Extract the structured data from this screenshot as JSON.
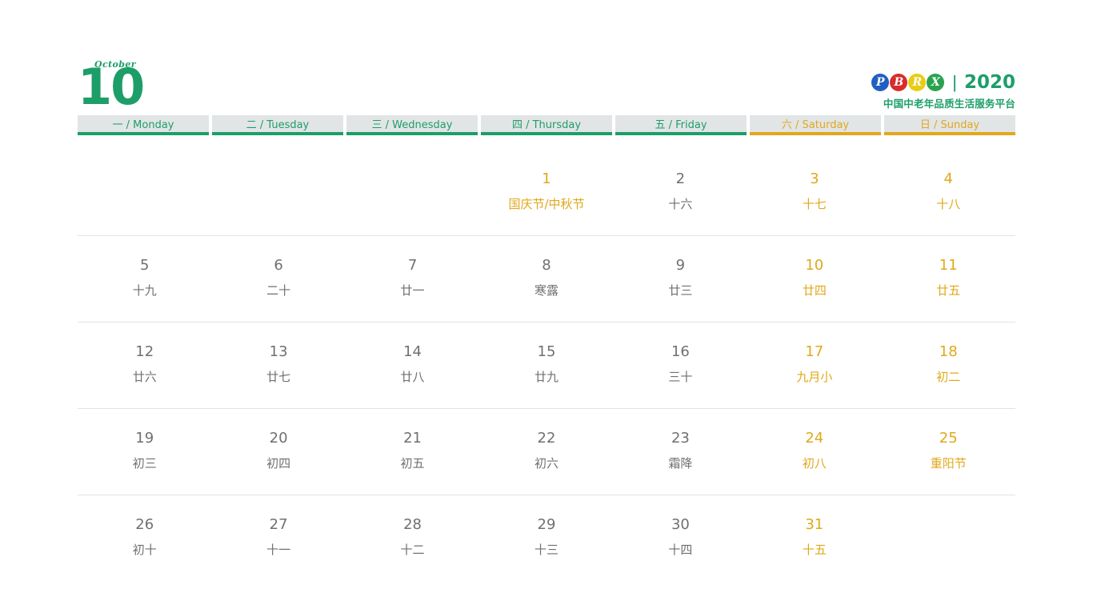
{
  "masthead": {
    "month_word": "October",
    "month_number": "10",
    "brand": {
      "letters": [
        {
          "char": "P",
          "color": "#1f5fc4"
        },
        {
          "char": "B",
          "color": "#d92b2b"
        },
        {
          "char": "R",
          "color": "#e8cd18"
        },
        {
          "char": "X",
          "color": "#2aa34f"
        }
      ],
      "separator": "|",
      "year": "2020",
      "subtitle": "中国中老年品质生活服务平台"
    }
  },
  "colors": {
    "green": "#1d9e69",
    "gold": "#e0a81b",
    "gray_text": "#6f7072",
    "header_bg": "#e2e5e6"
  },
  "weekdays": [
    {
      "label": "一 / Monday",
      "weekend": false
    },
    {
      "label": "二 / Tuesday",
      "weekend": false
    },
    {
      "label": "三 / Wednesday",
      "weekend": false
    },
    {
      "label": "四 / Thursday",
      "weekend": false
    },
    {
      "label": "五 / Friday",
      "weekend": false
    },
    {
      "label": "六 / Saturday",
      "weekend": true
    },
    {
      "label": "日 / Sunday",
      "weekend": true
    }
  ],
  "weeks": [
    [
      {
        "num": "",
        "sub": "",
        "gold": false,
        "empty": true
      },
      {
        "num": "",
        "sub": "",
        "gold": false,
        "empty": true
      },
      {
        "num": "",
        "sub": "",
        "gold": false,
        "empty": true
      },
      {
        "num": "1",
        "sub": "国庆节/中秋节",
        "gold": true,
        "empty": false
      },
      {
        "num": "2",
        "sub": "十六",
        "gold": false,
        "empty": false
      },
      {
        "num": "3",
        "sub": "十七",
        "gold": true,
        "empty": false
      },
      {
        "num": "4",
        "sub": "十八",
        "gold": true,
        "empty": false
      }
    ],
    [
      {
        "num": "5",
        "sub": "十九",
        "gold": false,
        "empty": false
      },
      {
        "num": "6",
        "sub": "二十",
        "gold": false,
        "empty": false
      },
      {
        "num": "7",
        "sub": "廿一",
        "gold": false,
        "empty": false
      },
      {
        "num": "8",
        "sub": "寒露",
        "gold": false,
        "empty": false
      },
      {
        "num": "9",
        "sub": "廿三",
        "gold": false,
        "empty": false
      },
      {
        "num": "10",
        "sub": "廿四",
        "gold": true,
        "empty": false
      },
      {
        "num": "11",
        "sub": "廿五",
        "gold": true,
        "empty": false
      }
    ],
    [
      {
        "num": "12",
        "sub": "廿六",
        "gold": false,
        "empty": false
      },
      {
        "num": "13",
        "sub": "廿七",
        "gold": false,
        "empty": false
      },
      {
        "num": "14",
        "sub": "廿八",
        "gold": false,
        "empty": false
      },
      {
        "num": "15",
        "sub": "廿九",
        "gold": false,
        "empty": false
      },
      {
        "num": "16",
        "sub": "三十",
        "gold": false,
        "empty": false
      },
      {
        "num": "17",
        "sub": "九月小",
        "gold": true,
        "empty": false
      },
      {
        "num": "18",
        "sub": "初二",
        "gold": true,
        "empty": false
      }
    ],
    [
      {
        "num": "19",
        "sub": "初三",
        "gold": false,
        "empty": false
      },
      {
        "num": "20",
        "sub": "初四",
        "gold": false,
        "empty": false
      },
      {
        "num": "21",
        "sub": "初五",
        "gold": false,
        "empty": false
      },
      {
        "num": "22",
        "sub": "初六",
        "gold": false,
        "empty": false
      },
      {
        "num": "23",
        "sub": "霜降",
        "gold": false,
        "empty": false
      },
      {
        "num": "24",
        "sub": "初八",
        "gold": true,
        "empty": false
      },
      {
        "num": "25",
        "sub": "重阳节",
        "gold": true,
        "empty": false
      }
    ],
    [
      {
        "num": "26",
        "sub": "初十",
        "gold": false,
        "empty": false
      },
      {
        "num": "27",
        "sub": "十一",
        "gold": false,
        "empty": false
      },
      {
        "num": "28",
        "sub": "十二",
        "gold": false,
        "empty": false
      },
      {
        "num": "29",
        "sub": "十三",
        "gold": false,
        "empty": false
      },
      {
        "num": "30",
        "sub": "十四",
        "gold": false,
        "empty": false
      },
      {
        "num": "31",
        "sub": "十五",
        "gold": true,
        "empty": false
      },
      {
        "num": "",
        "sub": "",
        "gold": false,
        "empty": true
      }
    ]
  ]
}
